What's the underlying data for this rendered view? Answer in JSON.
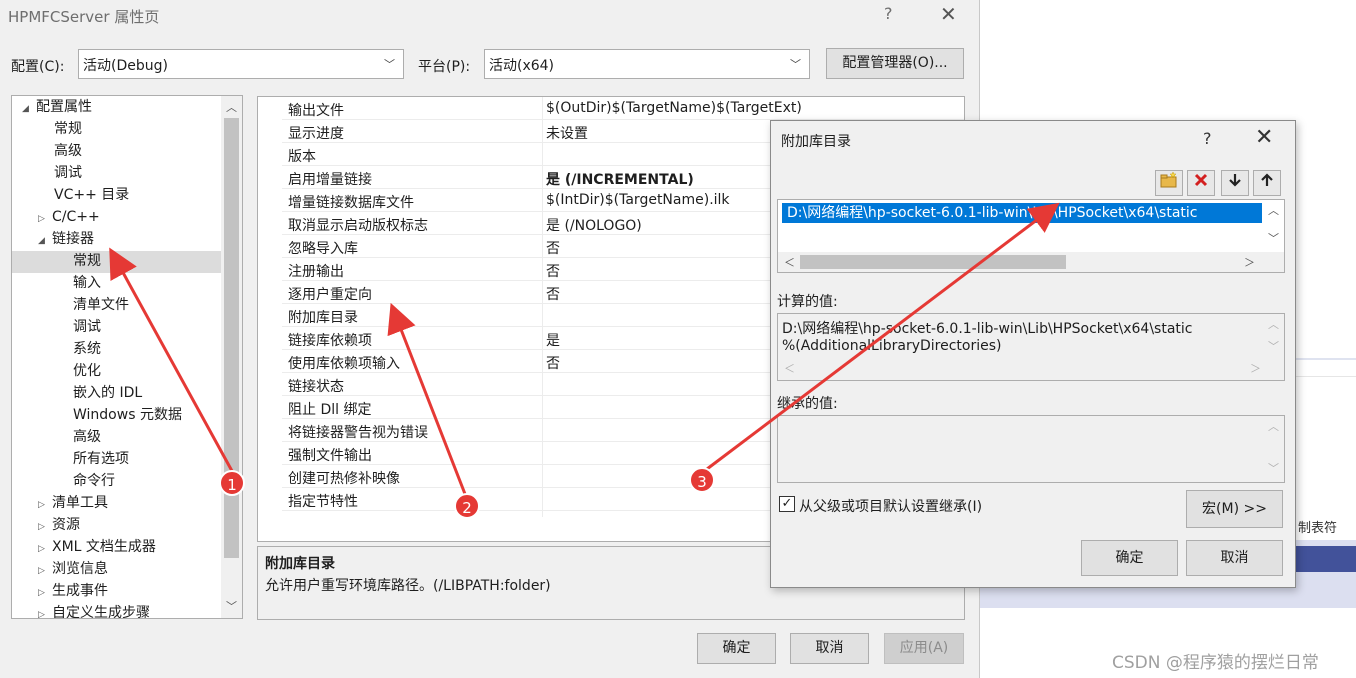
{
  "main": {
    "title": "HPMFCServer 属性页",
    "help": "?",
    "close": "✕",
    "config_label": "配置(C):",
    "config_value": "活动(Debug)",
    "platform_label": "平台(P):",
    "platform_value": "活动(x64)",
    "config_manager": "配置管理器(O)...",
    "ok": "确定",
    "cancel": "取消",
    "apply": "应用(A)"
  },
  "tree": [
    {
      "label": "配置属性",
      "twisty": "◢"
    },
    {
      "label": "常规",
      "twisty": ""
    },
    {
      "label": "高级",
      "twisty": ""
    },
    {
      "label": "调试",
      "twisty": ""
    },
    {
      "label": "VC++ 目录",
      "twisty": ""
    },
    {
      "label": "C/C++",
      "twisty": "▷"
    },
    {
      "label": "链接器",
      "twisty": "◢"
    },
    {
      "label": "常规",
      "twisty": ""
    },
    {
      "label": "输入",
      "twisty": ""
    },
    {
      "label": "清单文件",
      "twisty": ""
    },
    {
      "label": "调试",
      "twisty": ""
    },
    {
      "label": "系统",
      "twisty": ""
    },
    {
      "label": "优化",
      "twisty": ""
    },
    {
      "label": "嵌入的 IDL",
      "twisty": ""
    },
    {
      "label": "Windows 元数据",
      "twisty": ""
    },
    {
      "label": "高级",
      "twisty": ""
    },
    {
      "label": "所有选项",
      "twisty": ""
    },
    {
      "label": "命令行",
      "twisty": ""
    },
    {
      "label": "清单工具",
      "twisty": "▷"
    },
    {
      "label": "资源",
      "twisty": "▷"
    },
    {
      "label": "XML 文档生成器",
      "twisty": "▷"
    },
    {
      "label": "浏览信息",
      "twisty": "▷"
    },
    {
      "label": "生成事件",
      "twisty": "▷"
    },
    {
      "label": "自定义生成步骤",
      "twisty": "▷"
    }
  ],
  "properties": [
    {
      "name": "输出文件",
      "value": "$(OutDir)$(TargetName)$(TargetExt)",
      "bold": false
    },
    {
      "name": "显示进度",
      "value": "未设置",
      "bold": false
    },
    {
      "name": "版本",
      "value": "",
      "bold": false
    },
    {
      "name": "启用增量链接",
      "value": "是 (/INCREMENTAL)",
      "bold": true
    },
    {
      "name": "增量链接数据库文件",
      "value": "$(IntDir)$(TargetName).ilk",
      "bold": false
    },
    {
      "name": "取消显示启动版权标志",
      "value": "是 (/NOLOGO)",
      "bold": false
    },
    {
      "name": "忽略导入库",
      "value": "否",
      "bold": false
    },
    {
      "name": "注册输出",
      "value": "否",
      "bold": false
    },
    {
      "name": "逐用户重定向",
      "value": "否",
      "bold": false
    },
    {
      "name": "附加库目录",
      "value": "",
      "bold": false
    },
    {
      "name": "链接库依赖项",
      "value": "是",
      "bold": false
    },
    {
      "name": "使用库依赖项输入",
      "value": "否",
      "bold": false
    },
    {
      "name": "链接状态",
      "value": "",
      "bold": false
    },
    {
      "name": "阻止 Dll 绑定",
      "value": "",
      "bold": false
    },
    {
      "name": "将链接器警告视为错误",
      "value": "",
      "bold": false
    },
    {
      "name": "强制文件输出",
      "value": "",
      "bold": false
    },
    {
      "name": "创建可热修补映像",
      "value": "",
      "bold": false
    },
    {
      "name": "指定节特性",
      "value": "",
      "bold": false
    }
  ],
  "description": {
    "title": "附加库目录",
    "text": "允许用户重写环境库路径。(/LIBPATH:folder)"
  },
  "dialog": {
    "title": "附加库目录",
    "help": "?",
    "close": "✕",
    "entry": "D:\\网络编程\\hp-socket-6.0.1-lib-win\\Lib\\HPSocket\\x64\\static",
    "computed_label": "计算的值:",
    "computed_line1": "D:\\网络编程\\hp-socket-6.0.1-lib-win\\Lib\\HPSocket\\x64\\static",
    "computed_line2": "%(AdditionalLibraryDirectories)",
    "inherited_label": "继承的值:",
    "inherit_checkbox": "从父级或项目默认设置继承(I)",
    "macro": "宏(M) >>",
    "ok": "确定",
    "cancel": "取消"
  },
  "background": {
    "tab_text": "制表符",
    "watermark": "CSDN @程序猿的摆烂日常"
  },
  "annotations": [
    {
      "num": "1"
    },
    {
      "num": "2"
    },
    {
      "num": "3"
    }
  ],
  "accent": "#0078d7",
  "annotation_color": "#e53935"
}
